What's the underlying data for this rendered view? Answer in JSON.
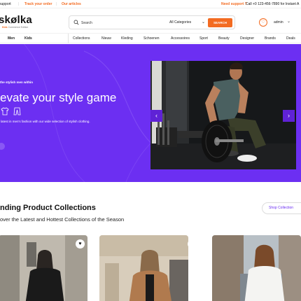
{
  "topbar": {
    "support_left": "support",
    "track": "Track your order",
    "articles": "Our articles",
    "need_support": "Need support ?",
    "call": "Call +0 123-456-7890 for Instant A"
  },
  "header": {
    "logo": "skølka",
    "logo_sub_prefix": "Kids",
    "logo_sub": "Commerce Edition",
    "search_placeholder": "Search",
    "category": "All Categories",
    "search_button": "SEARCH",
    "account_label": "admin"
  },
  "nav": {
    "left": [
      "Men",
      "Kids"
    ],
    "items": [
      "Collections",
      "Nieuw",
      "Kleding",
      "Schoenen",
      "Accessoires",
      "Sport",
      "Beauty",
      "Designer",
      "Brands",
      "Deals"
    ]
  },
  "hero": {
    "tag": "the stylish men within",
    "title": "evate your style game",
    "subtitle": "latest in men's fashion with our wide selection of stylish clothing.",
    "prev_arrow": "‹",
    "next_arrow": "›"
  },
  "trending": {
    "title": "nding Product Collections",
    "subtitle": "over the Latest and Hottest Collections of the Season",
    "shop_button": "Shop Collection"
  },
  "colors": {
    "accent": "#f36b21",
    "hero_bg": "#6c2ff2",
    "link": "#6c2ff2"
  }
}
